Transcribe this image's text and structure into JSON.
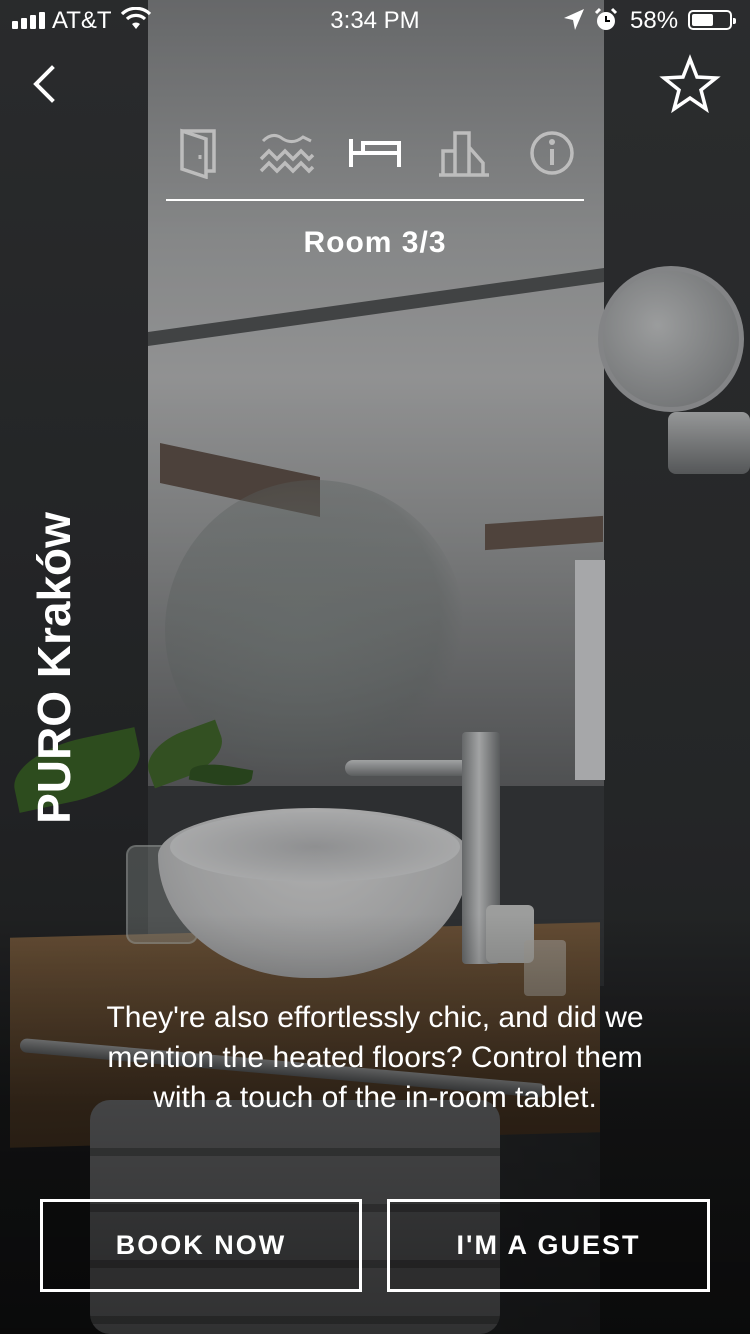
{
  "status_bar": {
    "carrier": "AT&T",
    "time": "3:34 PM",
    "battery_percent": "58%",
    "battery_level": 0.58,
    "icons": [
      "signal-icon",
      "wifi-icon",
      "location-icon",
      "alarm-icon",
      "battery-icon"
    ]
  },
  "nav": {
    "back_icon": "chevron-left-icon",
    "favorite_icon": "star-outline-icon"
  },
  "tabs": [
    {
      "icon": "door-icon",
      "active": false
    },
    {
      "icon": "waves-icon",
      "active": false
    },
    {
      "icon": "bed-icon",
      "active": true
    },
    {
      "icon": "city-buildings-icon",
      "active": false
    },
    {
      "icon": "info-icon",
      "active": false
    }
  ],
  "room_label": "Room 3/3",
  "hotel_name": "PURO Kraków",
  "caption": "They're also effortlessly chic, and did we mention the heated floors? Control them with a touch of the in-room tablet.",
  "buttons": {
    "book_now": "BOOK NOW",
    "guest": "I'M A GUEST"
  },
  "colors": {
    "text": "#ffffff",
    "inactive_icon": "#bdbdbd"
  }
}
